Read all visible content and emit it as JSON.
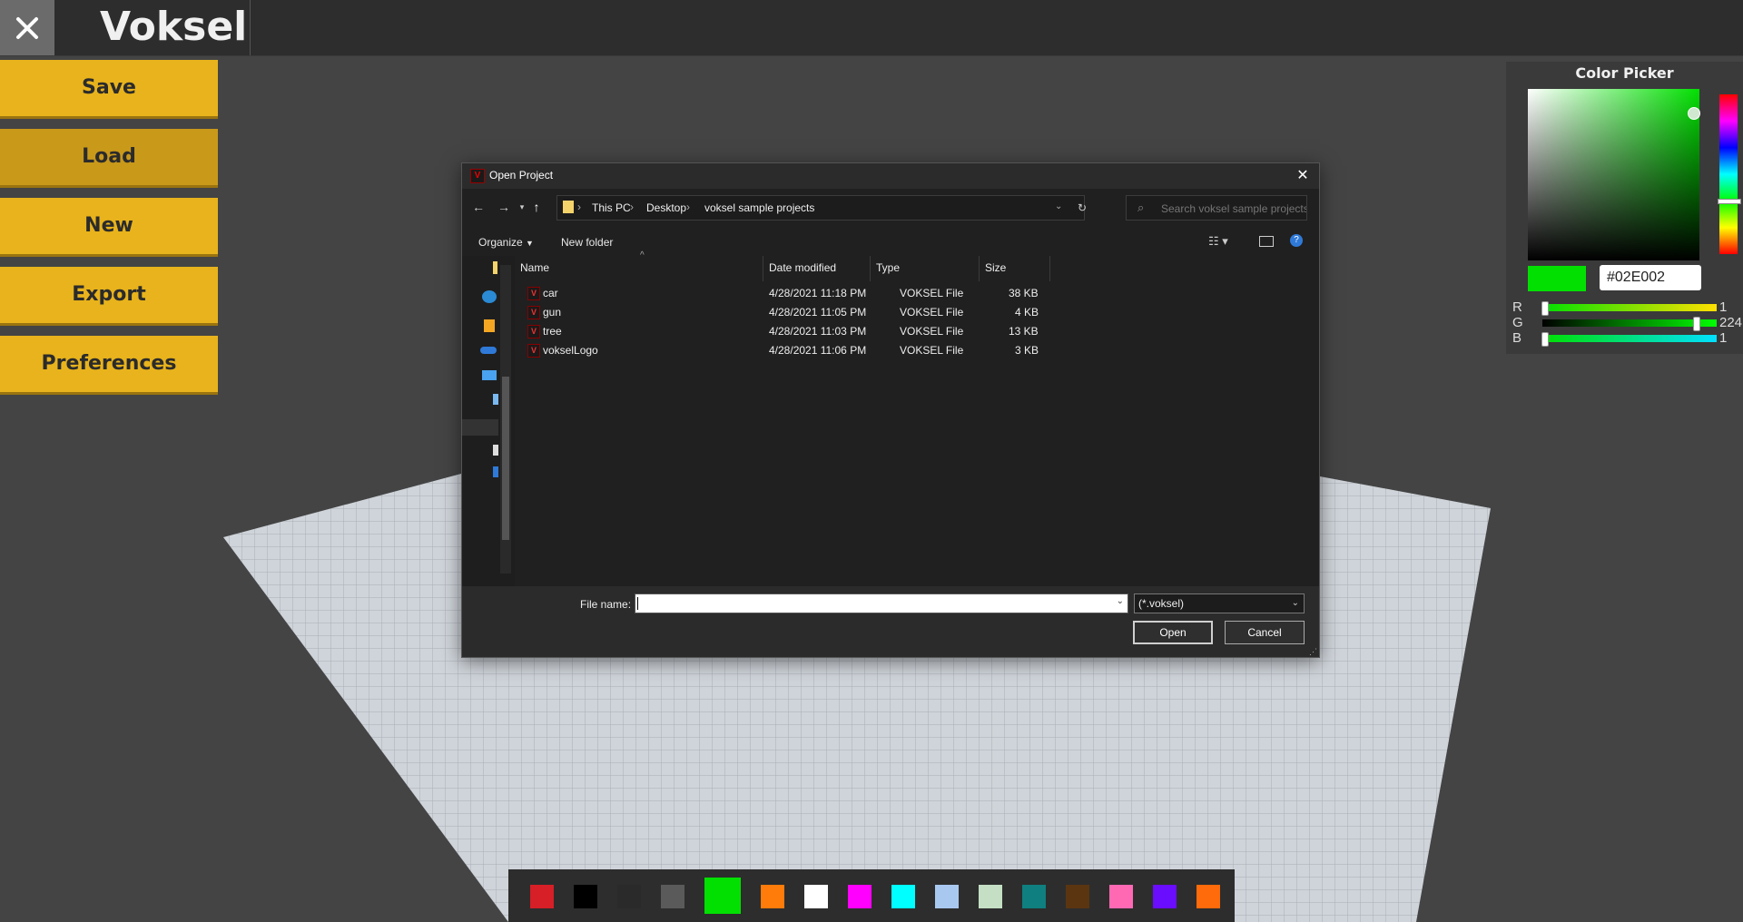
{
  "app": {
    "title": "Voksel"
  },
  "sidemenu": {
    "items": [
      {
        "label": "Save"
      },
      {
        "label": "Load"
      },
      {
        "label": "New"
      },
      {
        "label": "Export"
      },
      {
        "label": "Preferences"
      }
    ]
  },
  "color_picker": {
    "title": "Color Picker",
    "hex": "#02E002",
    "current_color": "#02E002",
    "r_label": "R",
    "g_label": "G",
    "b_label": "B",
    "r": "1",
    "g": "224",
    "b": "1"
  },
  "dialog": {
    "title": "Open Project",
    "breadcrumbs": [
      "This PC",
      "Desktop",
      "voksel sample projects"
    ],
    "search_placeholder": "Search voksel sample projects",
    "toolbar": {
      "organize": "Organize",
      "new_folder": "New folder"
    },
    "columns": [
      "Name",
      "Date modified",
      "Type",
      "Size"
    ],
    "files": [
      {
        "name": "car",
        "date": "4/28/2021 11:18 PM",
        "type": "VOKSEL File",
        "size": "38 KB"
      },
      {
        "name": "gun",
        "date": "4/28/2021 11:05 PM",
        "type": "VOKSEL File",
        "size": "4 KB"
      },
      {
        "name": "tree",
        "date": "4/28/2021 11:03 PM",
        "type": "VOKSEL File",
        "size": "13 KB"
      },
      {
        "name": "vokselLogo",
        "date": "4/28/2021 11:06 PM",
        "type": "VOKSEL File",
        "size": "3 KB"
      }
    ],
    "file_name_label": "File name:",
    "file_name_value": "",
    "filter": "(*.voksel)",
    "open_label": "Open",
    "cancel_label": "Cancel"
  },
  "palette": {
    "colors": [
      "#D61F26",
      "#000000",
      "#2A2A2A",
      "#5A5A5A",
      "#02E002",
      "#FF7B0A",
      "#FFFFFF",
      "#FF00FF",
      "#00FFFF",
      "#A9C8F0",
      "#C4DFC4",
      "#0F7F7F",
      "#5B3510",
      "#FF69B4",
      "#6A0DFF",
      "#FF6A0A"
    ],
    "selected_index": 4
  }
}
